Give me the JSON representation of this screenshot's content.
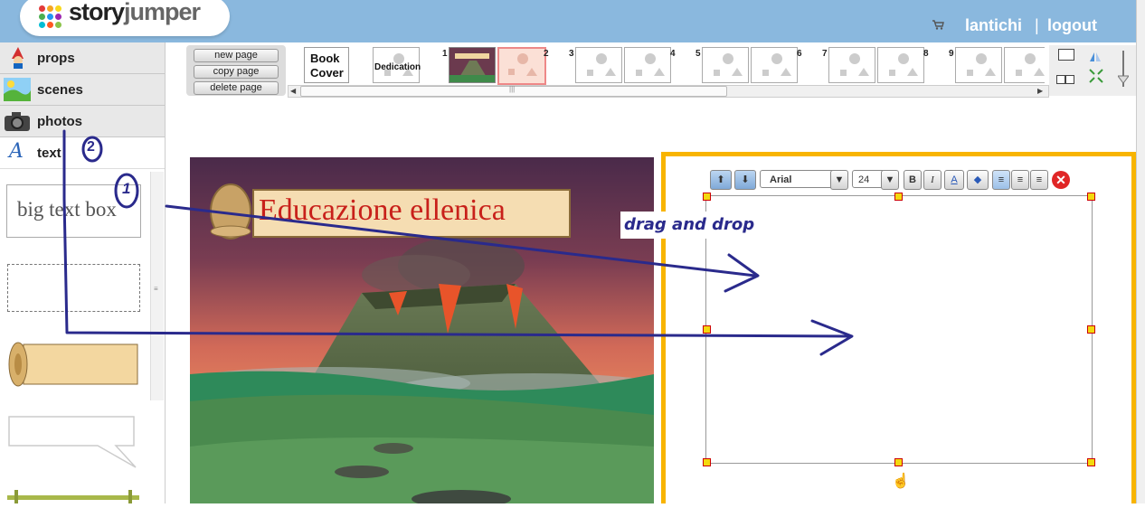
{
  "header": {
    "logo_story": "story",
    "logo_jumper": "jumper",
    "username": "lantichi",
    "separator": "|",
    "logout": "logout"
  },
  "sidebar": {
    "categories": [
      {
        "label": "props",
        "icon": "gnome-icon"
      },
      {
        "label": "scenes",
        "icon": "landscape-icon"
      },
      {
        "label": "photos",
        "icon": "camera-icon"
      },
      {
        "label": "text",
        "icon": "text-a-icon"
      }
    ],
    "items": [
      {
        "label": "big text box"
      }
    ]
  },
  "page_buttons": {
    "new_page": "new page",
    "copy_page": "copy page",
    "delete_page": "delete page"
  },
  "thumbnails": {
    "book_cover_1": "Book",
    "book_cover_2": "Cover",
    "dedication": "Dedication",
    "page_numbers": [
      "1",
      "2",
      "3",
      "4",
      "5",
      "6",
      "7",
      "8",
      "9"
    ]
  },
  "scene": {
    "title": "Educazione ellenica"
  },
  "text_toolbar": {
    "font": "Arial",
    "size": "24",
    "bold": "B",
    "italic": "I"
  },
  "annotations": {
    "drag_and_drop": "drag and drop",
    "marker_1": "1",
    "marker_2": "2"
  },
  "colors": {
    "header_bg": "#8ab8de",
    "page_border": "#f8b400",
    "annotation_ink": "#2a2a8c",
    "handle_fill": "#f3d90e",
    "handle_border": "#cc0000"
  }
}
